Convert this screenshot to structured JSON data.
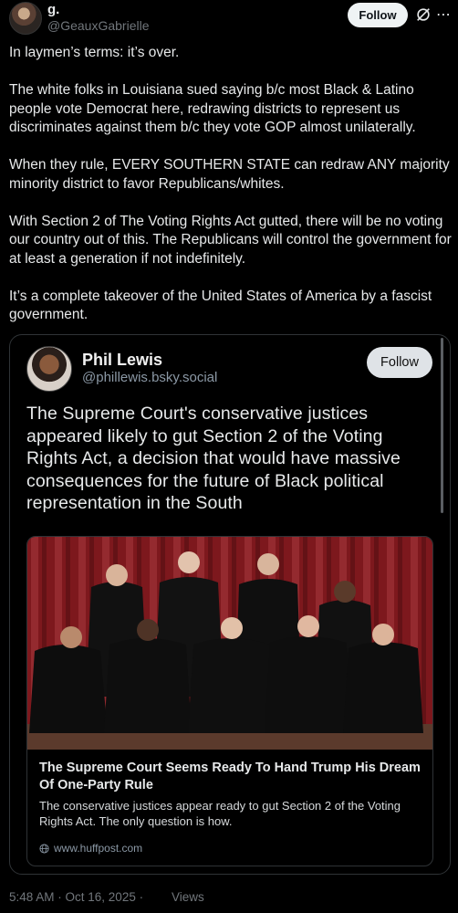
{
  "author": {
    "name": "g.",
    "handle": "@GeauxGabrielle",
    "follow_label": "Follow"
  },
  "post": {
    "paragraphs": [
      "In laymen’s terms: it’s over.",
      "The white folks in Louisiana sued saying b/c most Black & Latino people vote Democrat here, redrawing districts to represent us discriminates against them b/c they vote GOP almost unilaterally.",
      "When they rule, EVERY SOUTHERN STATE can redraw ANY majority minority district to favor Republicans/whites.",
      "With Section 2 of The Voting Rights Act gutted, there will be no voting our country out of this. The Republicans will control the government for at least a generation if not indefinitely.",
      "It’s a complete takeover of the United States of America by a fascist government."
    ],
    "timestamp": "5:48 AM · Oct 16, 2025 ·",
    "views_label": "Views"
  },
  "embed": {
    "name": "Phil Lewis",
    "handle": "@phillewis.bsky.social",
    "follow_label": "Follow",
    "text": "The Supreme Court's conservative justices appeared likely to gut Section 2 of the Voting Rights Act, a decision that would have massive consequences for the future of Black political representation in the South",
    "link": {
      "title": "The Supreme Court Seems Ready To Hand Trump His Dream Of One-Party Rule",
      "description": "The conservative justices appear ready to gut Section 2 of the Voting Rights Act. The only question is how.",
      "domain": "www.huffpost.com"
    }
  },
  "icons": {
    "more": "more-icon",
    "grok": "grok-icon",
    "globe": "globe-icon"
  },
  "colors": {
    "background": "#000000",
    "text": "#e7e9ea",
    "muted": "#71767b",
    "curtain": "#8b1e24"
  }
}
